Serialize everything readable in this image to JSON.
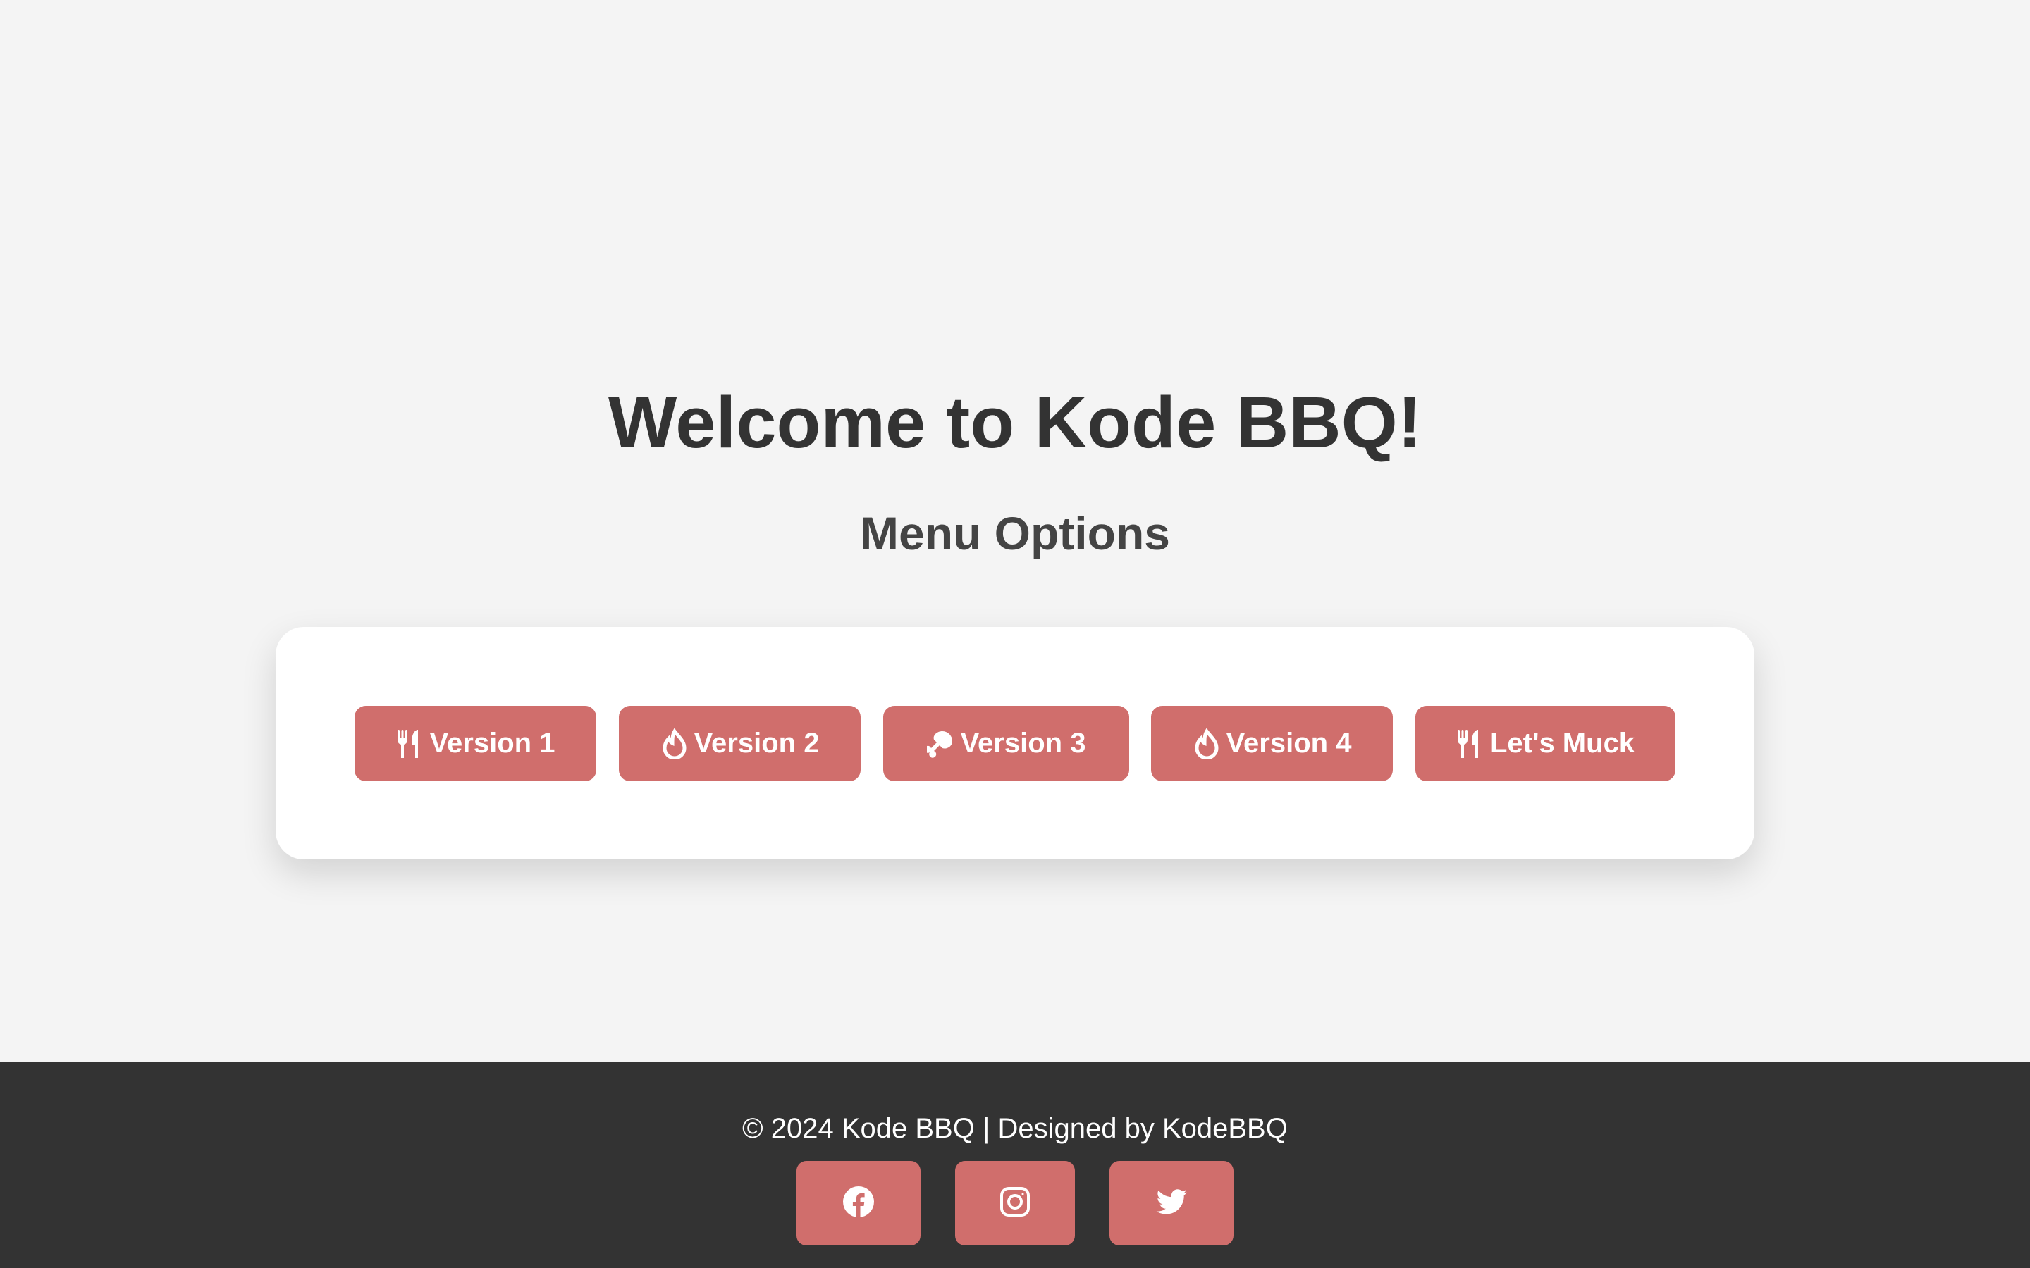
{
  "main": {
    "title": "Welcome to Kode BBQ!",
    "subtitle": "Menu Options"
  },
  "menu": {
    "buttons": [
      {
        "label": "Version 1",
        "icon": "utensils-icon"
      },
      {
        "label": "Version 2",
        "icon": "fire-icon"
      },
      {
        "label": "Version 3",
        "icon": "drumstick-icon"
      },
      {
        "label": "Version 4",
        "icon": "fire-icon"
      },
      {
        "label": "Let's Muck",
        "icon": "utensils-icon"
      }
    ]
  },
  "footer": {
    "copyright": "© 2024 Kode BBQ | Designed by KodeBBQ",
    "social": [
      {
        "icon": "facebook-icon"
      },
      {
        "icon": "instagram-icon"
      },
      {
        "icon": "twitter-icon"
      }
    ]
  },
  "colors": {
    "background": "#f4f4f4",
    "accent": "#d06e6c",
    "footer": "#333333",
    "title": "#333333",
    "card": "#ffffff"
  }
}
